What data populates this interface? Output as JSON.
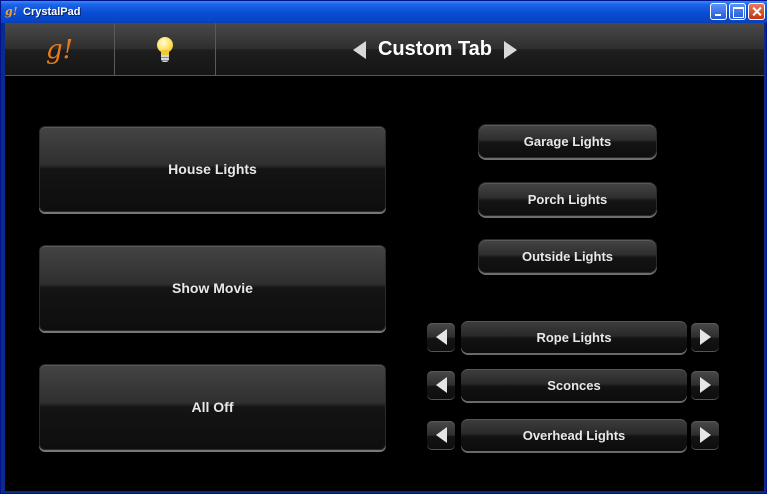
{
  "window": {
    "title": "CrystalPad",
    "logo_glyph": "g!"
  },
  "toolbar": {
    "brand_glyph": "g!",
    "bulb_icon": "lightbulb-icon",
    "tab_title": "Custom Tab"
  },
  "big_buttons": {
    "house_lights": "House Lights",
    "show_movie": "Show Movie",
    "all_off": "All Off"
  },
  "small_buttons": {
    "garage_lights": "Garage Lights",
    "porch_lights": "Porch Lights",
    "outside_lights": "Outside Lights"
  },
  "selectors": {
    "rope_lights": "Rope Lights",
    "sconces": "Sconces",
    "overhead_lights": "Overhead Lights"
  },
  "colors": {
    "titlebar": "#0a4fd6",
    "background": "#000000",
    "brand_orange": "#e87a1c",
    "button_text": "#e8e8e8"
  }
}
